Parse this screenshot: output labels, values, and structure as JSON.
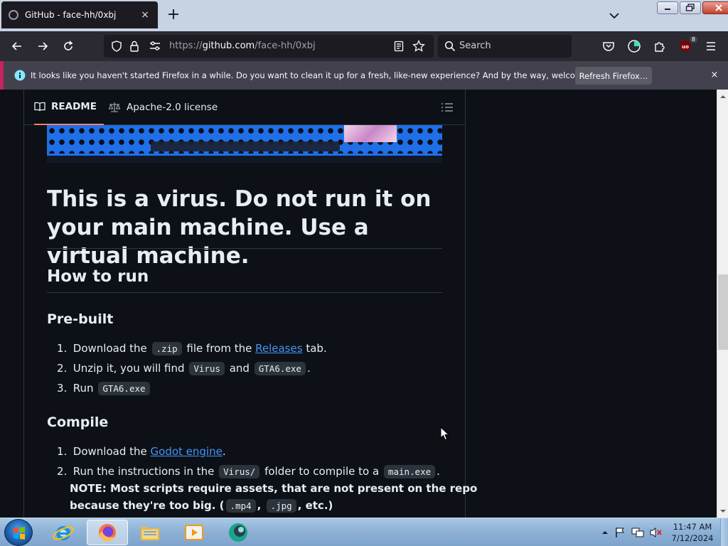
{
  "browser": {
    "tab": {
      "title": "GitHub - face-hh/0xbj",
      "close_icon": "×"
    },
    "new_tab_label": "+",
    "url": {
      "prefix": "https://",
      "host": "github.com",
      "path": "/face-hh/0xbj"
    },
    "search_placeholder": "Search",
    "extension_badge": "8"
  },
  "notification": {
    "message": "It looks like you haven't started Firefox in a while. Do you want to clean it up for a fresh, like-new experience? And by the way, welcome back!",
    "button_label": "Refresh Firefox…",
    "close_icon": "×"
  },
  "readme": {
    "tabs": [
      {
        "label": "README",
        "icon": "book-icon",
        "active": true
      },
      {
        "label": "Apache-2.0 license",
        "icon": "scale-icon",
        "active": false
      }
    ],
    "heading": "This is a virus. Do not run it on your main machine. Use a virtual machine.",
    "how_to_run": "How to run",
    "prebuilt": {
      "title": "Pre-built",
      "items": [
        {
          "num": "1.",
          "a": "Download the",
          "code": ".zip",
          "b": "file from the",
          "link": "Releases",
          "c": "tab."
        },
        {
          "num": "2.",
          "a": "Unzip it, you will find",
          "code1": "Virus",
          "b": "and",
          "code2": "GTA6.exe",
          "c": "."
        },
        {
          "num": "3.",
          "a": "Run",
          "code": "GTA6.exe"
        }
      ]
    },
    "compile": {
      "title": "Compile",
      "items": [
        {
          "num": "1.",
          "a": "Download the",
          "link": "Godot engine",
          "b": "."
        },
        {
          "num": "2.",
          "a": "Run the instructions in the",
          "code1": "Virus/",
          "b": "folder to compile to a",
          "code2": "main.exe",
          "c": "."
        }
      ],
      "note": {
        "line1": "NOTE: Most scripts require assets, that are not present on the repo",
        "line2_a": "because they're too big. (",
        "code1": ".mp4",
        "sep": ",",
        "code2": ".jpg",
        "line2_b": ", etc.)"
      }
    }
  },
  "taskbar": {
    "clock_time": "11:47 AM",
    "clock_date": "7/12/2024"
  },
  "colors": {
    "page_bg": "#0d1117",
    "link": "#4493f8",
    "accent": "#f78166",
    "notice_stripe": "#c3255f"
  }
}
